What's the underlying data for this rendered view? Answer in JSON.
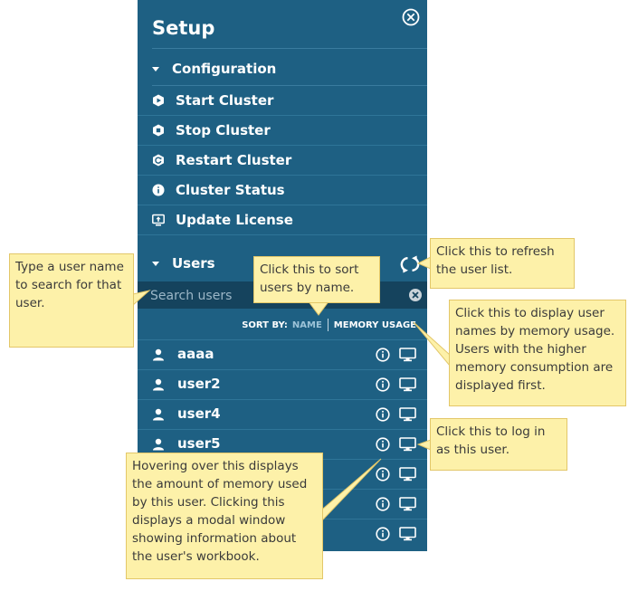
{
  "panel": {
    "title": "Setup",
    "configuration": {
      "heading": "Configuration",
      "items": [
        {
          "label": "Start Cluster",
          "icon": "hexagon-icon"
        },
        {
          "label": "Stop Cluster",
          "icon": "hexagon-outline-icon"
        },
        {
          "label": "Restart Cluster",
          "icon": "hexagon-restart-icon"
        },
        {
          "label": "Cluster Status",
          "icon": "info-circle-icon"
        },
        {
          "label": "Update License",
          "icon": "monitor-upload-icon"
        }
      ]
    },
    "users": {
      "heading": "Users",
      "search_placeholder": "Search users",
      "sort": {
        "label": "SORT BY:",
        "name": "NAME",
        "memory": "MEMORY USAGE"
      },
      "list": [
        "aaaa",
        "user2",
        "user4",
        "user5",
        "",
        "",
        ""
      ]
    }
  },
  "callouts": {
    "search": "Type a user name to search for that user.",
    "sort_name": "Click this to sort users by name.",
    "refresh": "Click this to refresh the user list.",
    "sort_memory": "Click this to display user names by memory usage. Users with the higher memory consumption are displayed first.",
    "login": "Click this to log in as this user.",
    "info": "Hovering over this displays the amount of memory used by this user. Clicking this displays a modal window showing information about the user's workbook."
  },
  "colors": {
    "panel": "#1e6083",
    "search_bar": "#15435d",
    "callout_fill": "#fdf1a9",
    "callout_border": "#e3c769"
  }
}
